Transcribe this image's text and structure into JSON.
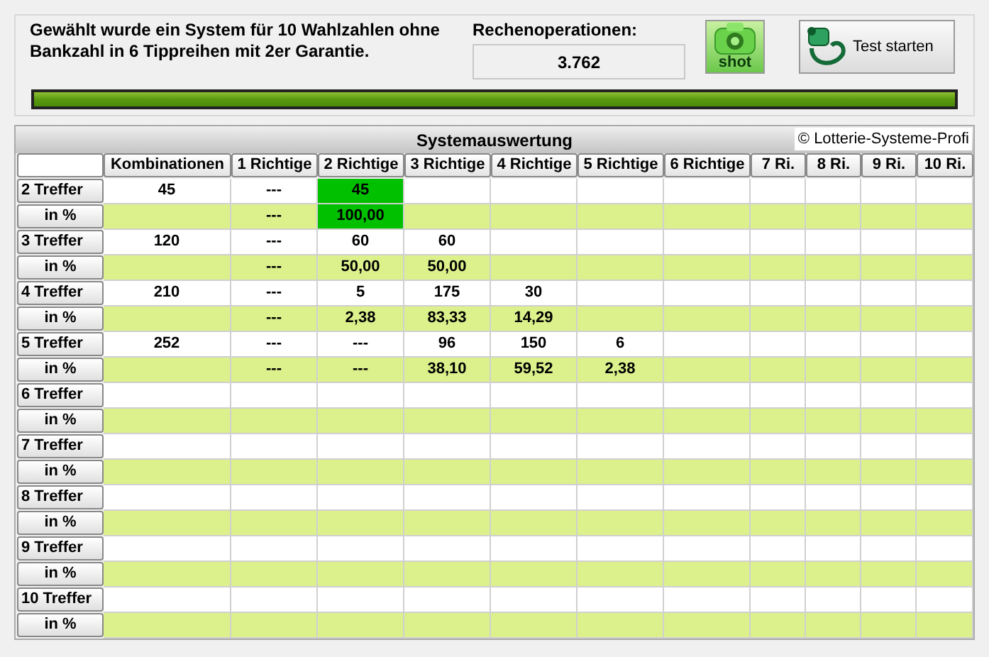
{
  "header": {
    "message": "Gewählt wurde ein System für 10 Wahlzahlen ohne Bankzahl in 6 Tippreihen mit 2er Garantie.",
    "ops_label": "Rechenoperationen:",
    "ops_value": "3.762",
    "shot_button": "shot",
    "test_button": "Test starten",
    "progress": {
      "level": 1
    }
  },
  "table": {
    "title": "Systemauswertung",
    "copyright": "© Lotterie-Systeme-Profi",
    "columns": [
      "Kombinationen",
      "1 Richtige",
      "2 Richtige",
      "3 Richtige",
      "4 Richtige",
      "5 Richtige",
      "6 Richtige",
      "7 Ri.",
      "8 Ri.",
      "9 Ri.",
      "10 Ri."
    ],
    "rows": [
      {
        "label": "2 Treffer",
        "kind": "count",
        "cells": [
          {
            "text": "45",
            "highlighted": false
          },
          {
            "text": "---",
            "highlighted": false
          },
          {
            "text": "45",
            "highlighted": true
          }
        ]
      },
      {
        "label": "in %",
        "kind": "percent",
        "cells": [
          null,
          {
            "text": "---",
            "highlighted": false
          },
          {
            "text": "100,00",
            "highlighted": true
          }
        ]
      },
      {
        "label": "3 Treffer",
        "kind": "count",
        "cells": [
          {
            "text": "120",
            "highlighted": false
          },
          {
            "text": "---",
            "highlighted": false
          },
          {
            "text": "60",
            "highlighted": false
          },
          {
            "text": "60",
            "highlighted": false
          }
        ]
      },
      {
        "label": "in %",
        "kind": "percent",
        "cells": [
          null,
          {
            "text": "---",
            "highlighted": false
          },
          {
            "text": "50,00",
            "highlighted": false
          },
          {
            "text": "50,00",
            "highlighted": false
          }
        ]
      },
      {
        "label": "4 Treffer",
        "kind": "count",
        "cells": [
          {
            "text": "210",
            "highlighted": false
          },
          {
            "text": "---",
            "highlighted": false
          },
          {
            "text": "5",
            "highlighted": false
          },
          {
            "text": "175",
            "highlighted": false
          },
          {
            "text": "30",
            "highlighted": false
          }
        ]
      },
      {
        "label": "in %",
        "kind": "percent",
        "cells": [
          null,
          {
            "text": "---",
            "highlighted": false
          },
          {
            "text": "2,38",
            "highlighted": false
          },
          {
            "text": "83,33",
            "highlighted": false
          },
          {
            "text": "14,29",
            "highlighted": false
          }
        ]
      },
      {
        "label": "5 Treffer",
        "kind": "count",
        "cells": [
          {
            "text": "252",
            "highlighted": false
          },
          {
            "text": "---",
            "highlighted": false
          },
          {
            "text": "---",
            "highlighted": false
          },
          {
            "text": "96",
            "highlighted": false
          },
          {
            "text": "150",
            "highlighted": false
          },
          {
            "text": "6",
            "highlighted": false
          }
        ]
      },
      {
        "label": "in %",
        "kind": "percent",
        "cells": [
          null,
          {
            "text": "---",
            "highlighted": false
          },
          {
            "text": "---",
            "highlighted": false
          },
          {
            "text": "38,10",
            "highlighted": false
          },
          {
            "text": "59,52",
            "highlighted": false
          },
          {
            "text": "2,38",
            "highlighted": false
          }
        ]
      },
      {
        "label": "6 Treffer",
        "kind": "count"
      },
      {
        "label": "in %",
        "kind": "percent"
      },
      {
        "label": "7 Treffer",
        "kind": "count"
      },
      {
        "label": "in %",
        "kind": "percent"
      },
      {
        "label": "8 Treffer",
        "kind": "count"
      },
      {
        "label": "in %",
        "kind": "percent"
      },
      {
        "label": "9 Treffer",
        "kind": "count"
      },
      {
        "label": "in %",
        "kind": "percent"
      },
      {
        "label": "10 Treffer",
        "kind": "count"
      },
      {
        "label": "in %",
        "kind": "percent"
      }
    ]
  }
}
